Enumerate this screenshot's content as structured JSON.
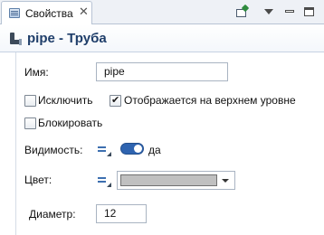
{
  "tab": {
    "icon": "properties-icon",
    "label": "Свойства",
    "close": "✕"
  },
  "toolbar": {
    "pin": "pin-icon",
    "menu": "view-menu-icon",
    "minimize": "minimize-icon",
    "maximize": "maximize-icon"
  },
  "title": {
    "icon": "pipe-icon",
    "text": "pipe - Труба"
  },
  "form": {
    "name_label": "Имя:",
    "name_value": "pipe",
    "exclude_label": "Исключить",
    "exclude_checked": false,
    "top_level_label": "Отображается на верхнем уровне",
    "top_level_checked": true,
    "lock_label": "Блокировать",
    "lock_checked": false,
    "visibility_label": "Видимость:",
    "visibility_value": "да",
    "color_label": "Цвет:",
    "color_value": "#c0c0c0",
    "diameter_label": "Диаметр:",
    "diameter_value": "12"
  }
}
